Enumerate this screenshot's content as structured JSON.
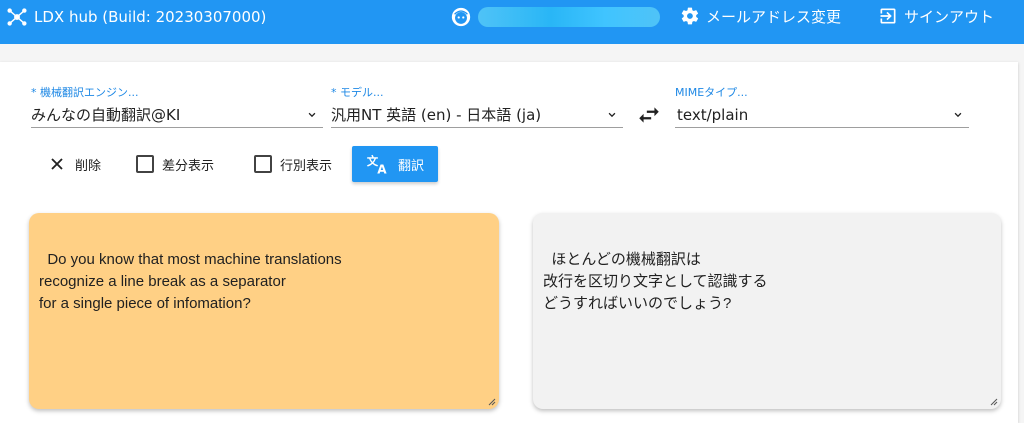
{
  "appbar": {
    "title": "LDX hub (Build: 20230307000)",
    "email_change": "メールアドレス変更",
    "sign_out": "サインアウト",
    "icons": {
      "brand": "hub-icon",
      "user": "user-face-icon",
      "email": "gear-icon",
      "signout": "logout-icon"
    }
  },
  "form": {
    "engine": {
      "label": "* 機械翻訳エンジン...",
      "value": "みんなの自動翻訳@KI"
    },
    "model": {
      "label": "* モデル...",
      "value": "汎用NT 英語 (en) - 日本語 (ja)"
    },
    "mime": {
      "label": "MIMEタイプ...",
      "value": "text/plain"
    }
  },
  "toolbar": {
    "delete_label": "削除",
    "diff_label": "差分表示",
    "line_label": "行別表示",
    "translate_label": "翻訳",
    "diff_checked": false,
    "line_checked": false
  },
  "source_text": "Do you know that most machine translations\nrecognize a line break as a separator\nfor a single piece of infomation?",
  "target_text": "ほとんどの機械翻訳は\n改行を区切り文字として認識する\nどうすればいいのでしょう?",
  "colors": {
    "primary": "#2196f3",
    "source_bg": "#ffd085",
    "target_bg": "#f2f2f2",
    "label": "#1e88e5"
  }
}
